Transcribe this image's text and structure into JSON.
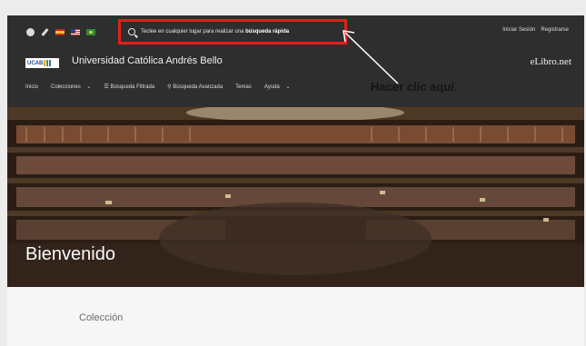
{
  "header": {
    "search_placeholder": "Teclee en cualquier lugar para realizar una",
    "search_emphasis": "búsqueda rápida",
    "auth": {
      "login": "Iniciar Sesión",
      "register": "Registrarse"
    },
    "logo_text": "UCAB",
    "university": "Universidad Católica Andrés Bello",
    "brand": "eLibro.net"
  },
  "nav": {
    "items": [
      {
        "label": "Inicio"
      },
      {
        "label": "Colecciones",
        "caret": "⌄"
      },
      {
        "label": "Búsqueda Filtrada",
        "icon": "filter-icon"
      },
      {
        "label": "Búsqueda Avanzada",
        "icon": "search-icon"
      },
      {
        "label": "Temas"
      },
      {
        "label": "Ayuda",
        "caret": "⌄"
      }
    ]
  },
  "hero": {
    "title": "Bienvenido"
  },
  "annotation": {
    "callout": "Hacer clic aquí."
  },
  "section": {
    "title": "Colección"
  },
  "colors": {
    "highlight": "#ea1b1b",
    "topbar": "#2e2e2e"
  }
}
